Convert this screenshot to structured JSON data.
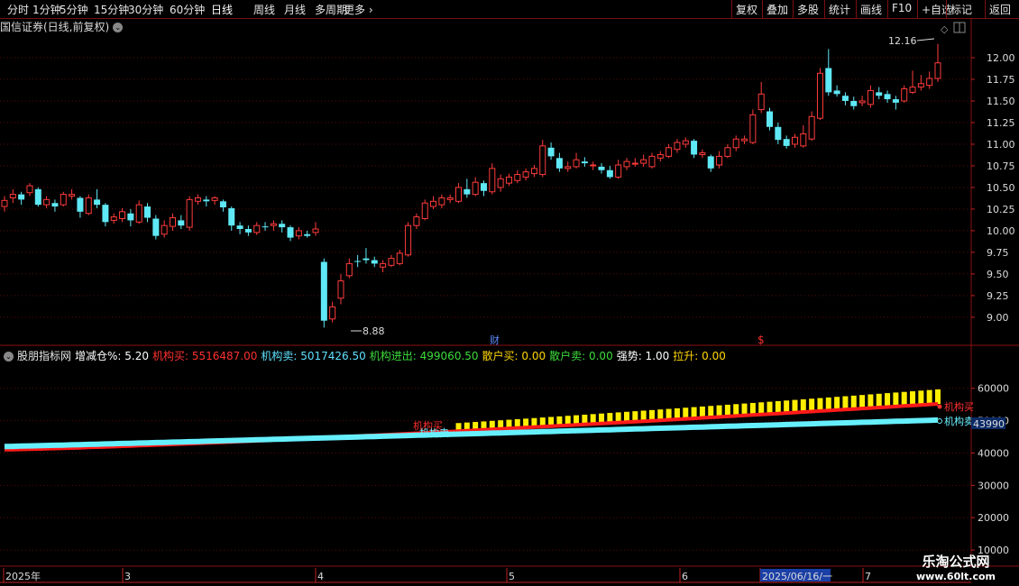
{
  "toolbar": {
    "left": [
      "分时",
      "1分钟",
      "5分钟",
      "15分钟",
      "30分钟",
      "60分钟",
      "日线",
      "周线",
      "月线",
      "多周期",
      "更多"
    ],
    "active": "日线",
    "right": [
      "复权",
      "叠加",
      "多股",
      "统计",
      "画线",
      "F10",
      "+自选",
      "标记",
      "返回"
    ]
  },
  "stock": {
    "title": "国信证券(日线,前复权)"
  },
  "main_axis": {
    "ticks": [
      "12.00",
      "11.75",
      "11.50",
      "11.25",
      "11.00",
      "10.75",
      "10.50",
      "10.25",
      "10.00",
      "9.75",
      "9.50",
      "9.25",
      "9.00"
    ]
  },
  "annotations": {
    "high": "12.16",
    "low": "8.88",
    "fin_marker": "财",
    "dollar_marker": "$"
  },
  "indicator": {
    "name": "股朋指标网",
    "fields": [
      {
        "label": "增减仓%: ",
        "value": "5.20",
        "color": "#ffffff"
      },
      {
        "label": "机构买: ",
        "value": "5516487.00",
        "color": "#ff3030"
      },
      {
        "label": "机构卖: ",
        "value": "5017426.50",
        "color": "#5fe0ff"
      },
      {
        "label": "机构进出: ",
        "value": "499060.50",
        "color": "#3cdc3c"
      },
      {
        "label": "散户买: ",
        "value": "0.00",
        "color": "#ffd700"
      },
      {
        "label": "散户卖: ",
        "value": "0.00",
        "color": "#3cdc3c"
      },
      {
        "label": "强势: ",
        "value": "1.00",
        "color": "#ffffff"
      },
      {
        "label": "拉升: ",
        "value": "0.00",
        "color": "#ffd700"
      }
    ],
    "axis_ticks": [
      "60000",
      "50000",
      "40000",
      "30000",
      "20000",
      "10000"
    ],
    "current_value": "43990",
    "buy_label": "机构买",
    "sell_label": "机构卖",
    "start_buy_label": "机构买",
    "start_sell_label": "机构卖"
  },
  "date_axis": {
    "labels": [
      "2025年",
      "3",
      "4",
      "5",
      "6",
      "2025/06/16/一",
      "7"
    ]
  },
  "watermark": {
    "line1": "乐淘公式网",
    "line2": "www.60lt.com"
  },
  "chart_data": {
    "type": "candlestick",
    "ylim": [
      8.78,
      12.25
    ],
    "candles": [
      [
        10.28,
        10.35,
        10.4,
        10.22
      ],
      [
        10.38,
        10.42,
        10.48,
        10.32
      ],
      [
        10.42,
        10.36,
        10.45,
        10.3
      ],
      [
        10.44,
        10.52,
        10.55,
        10.4
      ],
      [
        10.48,
        10.3,
        10.5,
        10.28
      ],
      [
        10.3,
        10.36,
        10.4,
        10.26
      ],
      [
        10.32,
        10.28,
        10.36,
        10.22
      ],
      [
        10.3,
        10.42,
        10.45,
        10.28
      ],
      [
        10.4,
        10.42,
        10.48,
        10.36
      ],
      [
        10.38,
        10.22,
        10.4,
        10.15
      ],
      [
        10.2,
        10.38,
        10.42,
        10.18
      ],
      [
        10.36,
        10.3,
        10.48,
        10.26
      ],
      [
        10.3,
        10.1,
        10.32,
        10.05
      ],
      [
        10.12,
        10.16,
        10.2,
        10.08
      ],
      [
        10.14,
        10.22,
        10.26,
        10.1
      ],
      [
        10.2,
        10.12,
        10.25,
        10.05
      ],
      [
        10.1,
        10.3,
        10.35,
        10.08
      ],
      [
        10.28,
        10.15,
        10.32,
        10.1
      ],
      [
        10.14,
        9.94,
        10.18,
        9.9
      ],
      [
        9.96,
        10.06,
        10.12,
        9.92
      ],
      [
        10.05,
        10.15,
        10.2,
        10.0
      ],
      [
        10.12,
        10.06,
        10.18,
        10.02
      ],
      [
        10.04,
        10.36,
        10.4,
        10.0
      ],
      [
        10.34,
        10.38,
        10.42,
        10.3
      ],
      [
        10.36,
        10.34,
        10.4,
        10.28
      ],
      [
        10.35,
        10.38,
        10.4,
        10.3
      ],
      [
        10.34,
        10.27,
        10.36,
        10.22
      ],
      [
        10.26,
        10.06,
        10.28,
        10.0
      ],
      [
        10.06,
        10.02,
        10.1,
        9.96
      ],
      [
        10.02,
        9.98,
        10.06,
        9.94
      ],
      [
        9.98,
        10.06,
        10.1,
        9.95
      ],
      [
        10.05,
        10.04,
        10.1,
        10.0
      ],
      [
        10.06,
        10.08,
        10.12,
        10.0
      ],
      [
        10.08,
        10.04,
        10.12,
        9.98
      ],
      [
        10.04,
        9.92,
        10.06,
        9.88
      ],
      [
        9.94,
        10.0,
        10.04,
        9.9
      ],
      [
        9.96,
        9.94,
        10.0,
        9.92
      ],
      [
        9.98,
        10.02,
        10.1,
        9.94
      ],
      [
        9.64,
        8.96,
        9.68,
        8.88
      ],
      [
        8.98,
        9.12,
        9.18,
        8.94
      ],
      [
        9.22,
        9.42,
        9.5,
        9.15
      ],
      [
        9.48,
        9.62,
        9.68,
        9.45
      ],
      [
        9.65,
        9.64,
        9.72,
        9.58
      ],
      [
        9.68,
        9.66,
        9.8,
        9.62
      ],
      [
        9.66,
        9.62,
        9.7,
        9.58
      ],
      [
        9.58,
        9.62,
        9.66,
        9.52
      ],
      [
        9.6,
        9.68,
        9.72,
        9.58
      ],
      [
        9.62,
        9.74,
        9.78,
        9.6
      ],
      [
        9.72,
        10.06,
        10.1,
        9.7
      ],
      [
        10.06,
        10.16,
        10.2,
        10.02
      ],
      [
        10.14,
        10.32,
        10.36,
        10.12
      ],
      [
        10.28,
        10.34,
        10.4,
        10.25
      ],
      [
        10.3,
        10.38,
        10.42,
        10.26
      ],
      [
        10.36,
        10.38,
        10.42,
        10.32
      ],
      [
        10.34,
        10.5,
        10.55,
        10.32
      ],
      [
        10.48,
        10.42,
        10.6,
        10.38
      ],
      [
        10.42,
        10.56,
        10.62,
        10.4
      ],
      [
        10.55,
        10.46,
        10.58,
        10.4
      ],
      [
        10.45,
        10.72,
        10.78,
        10.42
      ],
      [
        10.5,
        10.6,
        10.65,
        10.45
      ],
      [
        10.55,
        10.62,
        10.66,
        10.52
      ],
      [
        10.58,
        10.65,
        10.7,
        10.55
      ],
      [
        10.62,
        10.68,
        10.72,
        10.58
      ],
      [
        10.66,
        10.72,
        10.76,
        10.62
      ],
      [
        10.65,
        10.98,
        11.05,
        10.62
      ],
      [
        10.96,
        10.86,
        11.02,
        10.82
      ],
      [
        10.84,
        10.72,
        10.9,
        10.68
      ],
      [
        10.72,
        10.74,
        10.8,
        10.68
      ],
      [
        10.74,
        10.82,
        10.9,
        10.72
      ],
      [
        10.8,
        10.78,
        10.85,
        10.74
      ],
      [
        10.76,
        10.76,
        10.8,
        10.7
      ],
      [
        10.74,
        10.7,
        10.78,
        10.66
      ],
      [
        10.7,
        10.62,
        10.75,
        10.6
      ],
      [
        10.62,
        10.76,
        10.82,
        10.6
      ],
      [
        10.74,
        10.8,
        10.84,
        10.7
      ],
      [
        10.78,
        10.78,
        10.84,
        10.74
      ],
      [
        10.78,
        10.82,
        10.88,
        10.74
      ],
      [
        10.74,
        10.86,
        10.9,
        10.72
      ],
      [
        10.84,
        10.88,
        10.92,
        10.8
      ],
      [
        10.86,
        10.96,
        11.0,
        10.84
      ],
      [
        10.94,
        11.02,
        11.06,
        10.9
      ],
      [
        11.0,
        11.04,
        11.08,
        10.96
      ],
      [
        11.04,
        10.88,
        11.06,
        10.84
      ],
      [
        10.88,
        10.9,
        10.94,
        10.84
      ],
      [
        10.86,
        10.72,
        10.88,
        10.68
      ],
      [
        10.76,
        10.86,
        10.92,
        10.72
      ],
      [
        10.86,
        10.96,
        11.0,
        10.84
      ],
      [
        10.96,
        11.06,
        11.1,
        10.92
      ],
      [
        11.04,
        11.06,
        11.1,
        11.0
      ],
      [
        11.02,
        11.34,
        11.4,
        11.0
      ],
      [
        11.4,
        11.58,
        11.72,
        11.36
      ],
      [
        11.38,
        11.2,
        11.42,
        11.16
      ],
      [
        11.2,
        11.05,
        11.25,
        11.0
      ],
      [
        11.06,
        10.98,
        11.1,
        10.95
      ],
      [
        11.0,
        11.08,
        11.12,
        10.96
      ],
      [
        10.98,
        11.12,
        11.22,
        10.96
      ],
      [
        11.06,
        11.32,
        11.38,
        11.04
      ],
      [
        11.3,
        11.82,
        11.88,
        11.28
      ],
      [
        11.88,
        11.6,
        12.1,
        11.56
      ],
      [
        11.62,
        11.58,
        11.68,
        11.55
      ],
      [
        11.56,
        11.5,
        11.6,
        11.45
      ],
      [
        11.5,
        11.44,
        11.55,
        11.4
      ],
      [
        11.48,
        11.5,
        11.56,
        11.44
      ],
      [
        11.46,
        11.62,
        11.68,
        11.42
      ],
      [
        11.6,
        11.56,
        11.66,
        11.52
      ],
      [
        11.58,
        11.52,
        11.62,
        11.48
      ],
      [
        11.52,
        11.48,
        11.56,
        11.4
      ],
      [
        11.5,
        11.64,
        11.68,
        11.48
      ],
      [
        11.6,
        11.66,
        11.85,
        11.58
      ],
      [
        11.66,
        11.7,
        11.8,
        11.62
      ],
      [
        11.68,
        11.76,
        11.84,
        11.64
      ],
      [
        11.76,
        11.94,
        12.16,
        11.72
      ]
    ],
    "indicator": {
      "ylim": [
        5000,
        68000
      ],
      "red_line": {
        "x_start_index": 0,
        "y_start": 41000,
        "y_end": 55164
      },
      "cyan_line": {
        "x_start_index": 0,
        "y_start": 42000,
        "y_end": 50174
      },
      "yellow_bars_start_index": 54
    }
  }
}
